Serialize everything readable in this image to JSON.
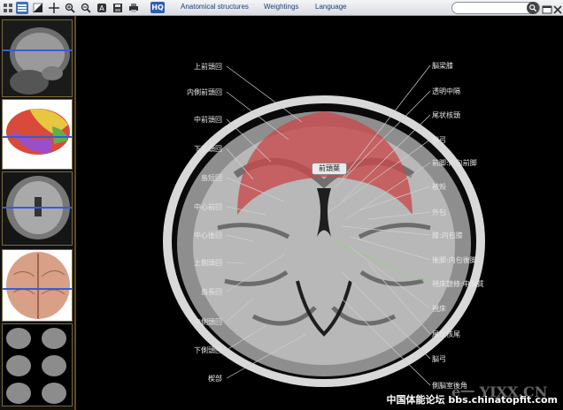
{
  "toolbar": {
    "menu": [
      "Anatomical structures",
      "Weightings",
      "Language"
    ],
    "hq_label": "HQ",
    "search": {
      "value": "",
      "placeholder": ""
    }
  },
  "bubble": "前頭葉",
  "labels_left": [
    "上前頭回",
    "内側前頭回",
    "中前頭回",
    "下前頭回",
    "島短回",
    "中心前回",
    "中心後回",
    "上側頭回",
    "島長回",
    "中側頭回",
    "下側頭回",
    "楔部"
  ],
  "labels_right": [
    "脳梁膝",
    "透明中隔",
    "尾状核頭",
    "脳弓",
    "前脚:内包前脚",
    "被殻",
    "外包",
    "膝:内包膝",
    "後脚:内包後脚",
    "視床髄條:中腦質",
    "視床",
    "尾状核尾",
    "脳弓",
    "側脳室後角"
  ],
  "watermark": "中国体能论坛 bbs.chinatopfit.com",
  "logo_text": "e一 YIXX.CN",
  "colors": {
    "overlay": "#c9494a",
    "accent": "#3f6fb8"
  }
}
